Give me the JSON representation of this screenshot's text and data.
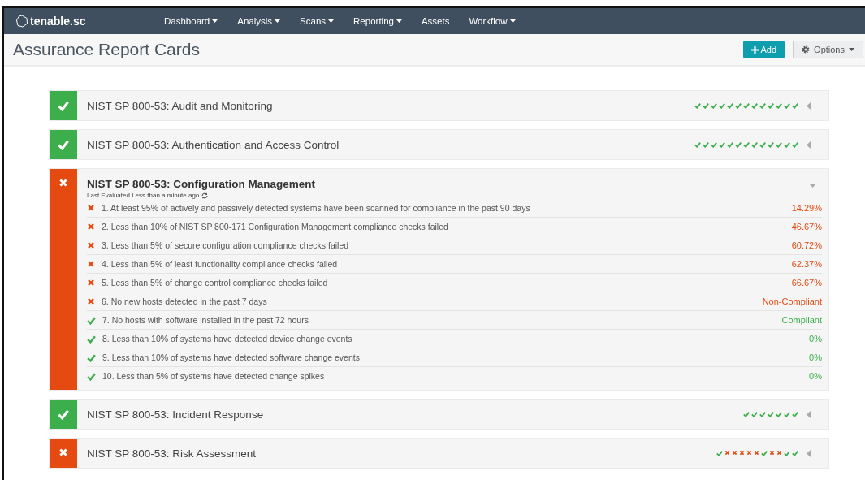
{
  "brand": {
    "name": "tenable.sc"
  },
  "nav": [
    {
      "label": "Dashboard",
      "dropdown": true
    },
    {
      "label": "Analysis",
      "dropdown": true
    },
    {
      "label": "Scans",
      "dropdown": true
    },
    {
      "label": "Reporting",
      "dropdown": true
    },
    {
      "label": "Assets",
      "dropdown": false
    },
    {
      "label": "Workflow",
      "dropdown": true
    }
  ],
  "page_title": "Assurance Report Cards",
  "actions": {
    "add": "Add",
    "options": "Options"
  },
  "cards": [
    {
      "title": "NIST SP 800-53: Audit and Monitoring",
      "passed": true,
      "expanded": false,
      "results": [
        true,
        true,
        true,
        true,
        true,
        true,
        true,
        true,
        true,
        true,
        true,
        true,
        true
      ]
    },
    {
      "title": "NIST SP 800-53: Authentication and Access Control",
      "passed": true,
      "expanded": false,
      "results": [
        true,
        true,
        true,
        true,
        true,
        true,
        true,
        true,
        true,
        true,
        true,
        true,
        true
      ]
    },
    {
      "title": "NIST SP 800-53: Configuration Management",
      "passed": false,
      "expanded": true,
      "evaluated": "Last Evaluated Less than a minute ago",
      "items": [
        {
          "text": "1. At least 95% of actively and passively detected systems have been scanned for compliance in the past 90 days",
          "passed": false,
          "value": "14.29%"
        },
        {
          "text": "2. Less than 10% of NIST SP 800-171 Configuration Management compliance checks failed",
          "passed": false,
          "value": "46.67%"
        },
        {
          "text": "3. Less than 5% of secure configuration compliance checks failed",
          "passed": false,
          "value": "60.72%"
        },
        {
          "text": "4. Less than 5% of least functionality compliance checks failed",
          "passed": false,
          "value": "62.37%"
        },
        {
          "text": "5. Less than 5% of change control compliance checks failed",
          "passed": false,
          "value": "66.67%"
        },
        {
          "text": "6. No new hosts detected in the past 7 days",
          "passed": false,
          "value": "Non-Compliant"
        },
        {
          "text": "7. No hosts with software installed in the past 72 hours",
          "passed": true,
          "value": "Compliant"
        },
        {
          "text": "8. Less than 10% of systems have detected device change events",
          "passed": true,
          "value": "0%"
        },
        {
          "text": "9. Less than 10% of systems have detected software change events",
          "passed": true,
          "value": "0%"
        },
        {
          "text": "10. Less than 5% of systems have detected change spikes",
          "passed": true,
          "value": "0%"
        }
      ]
    },
    {
      "title": "NIST SP 800-53: Incident Response",
      "passed": true,
      "expanded": false,
      "results": [
        true,
        true,
        true,
        true,
        true,
        true,
        true
      ]
    },
    {
      "title": "NIST SP 800-53: Risk Assessment",
      "passed": false,
      "expanded": false,
      "results": [
        true,
        false,
        false,
        false,
        false,
        false,
        true,
        false,
        false,
        true,
        true
      ]
    }
  ]
}
